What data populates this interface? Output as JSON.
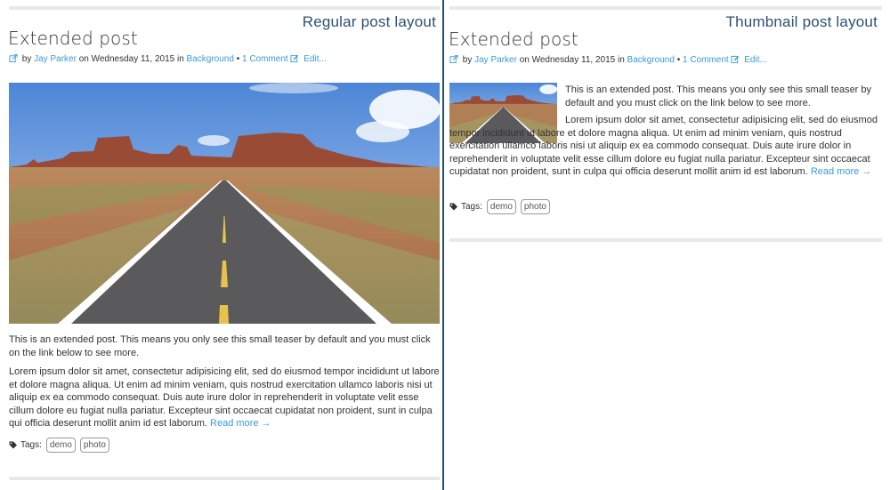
{
  "left": {
    "layout_label": "Regular post layout",
    "title": "Extended post",
    "meta": {
      "by": "by",
      "author": "Jay Parker",
      "on": "on Wednesday 11, 2015 in",
      "category": "Background",
      "sep": "•",
      "comments": "1 Comment",
      "edit": "Edit..."
    },
    "teaser": "This is an extended post. This means you only see this small teaser by default and you must click on the link below to see more.",
    "body": "Lorem ipsum dolor sit amet, consectetur adipisicing elit, sed do eiusmod tempor incididunt ut labore et dolore magna aliqua. Ut enim ad minim veniam, quis nostrud exercitation ullamco laboris nisi ut aliquip ex ea commodo consequat. Duis aute irure dolor in reprehenderit in voluptate velit esse cillum dolore eu fugiat nulla pariatur. Excepteur sint occaecat cupidatat non proident, sunt in culpa qui officia deserunt mollit anim id est laborum.",
    "read_more": "Read more →",
    "tags_label": "Tags:",
    "tags": [
      "demo",
      "photo"
    ]
  },
  "right": {
    "layout_label": "Thumbnail post layout",
    "title": "Extended post",
    "meta": {
      "by": "by",
      "author": "Jay Parker",
      "on": "on Wednesday 11, 2015 in",
      "category": "Background",
      "sep": "•",
      "comments": "1 Comment",
      "edit": "Edit..."
    },
    "teaser": "This is an extended post. This means you only see this small teaser by default and you must click on the link below to see more.",
    "body": "Lorem ipsum dolor sit amet, consectetur adipisicing elit, sed do eiusmod tempor incididunt ut labore et dolore magna aliqua. Ut enim ad minim veniam, quis nostrud exercitation ullamco laboris nisi ut aliquip ex ea commodo consequat. Duis aute irure dolor in reprehenderit in voluptate velit esse cillum dolore eu fugiat nulla pariatur. Excepteur sint occaecat cupidatat non proident, sunt in culpa qui officia deserunt mollit anim id est laborum.",
    "read_more": "Read more →",
    "tags_label": "Tags:",
    "tags": [
      "demo",
      "photo"
    ]
  },
  "colors": {
    "link": "#3a9ad9",
    "label": "#2d5174",
    "divider": "#2a4d6e"
  },
  "icons": {
    "edit": "edit-icon",
    "tag": "tags-icon"
  }
}
